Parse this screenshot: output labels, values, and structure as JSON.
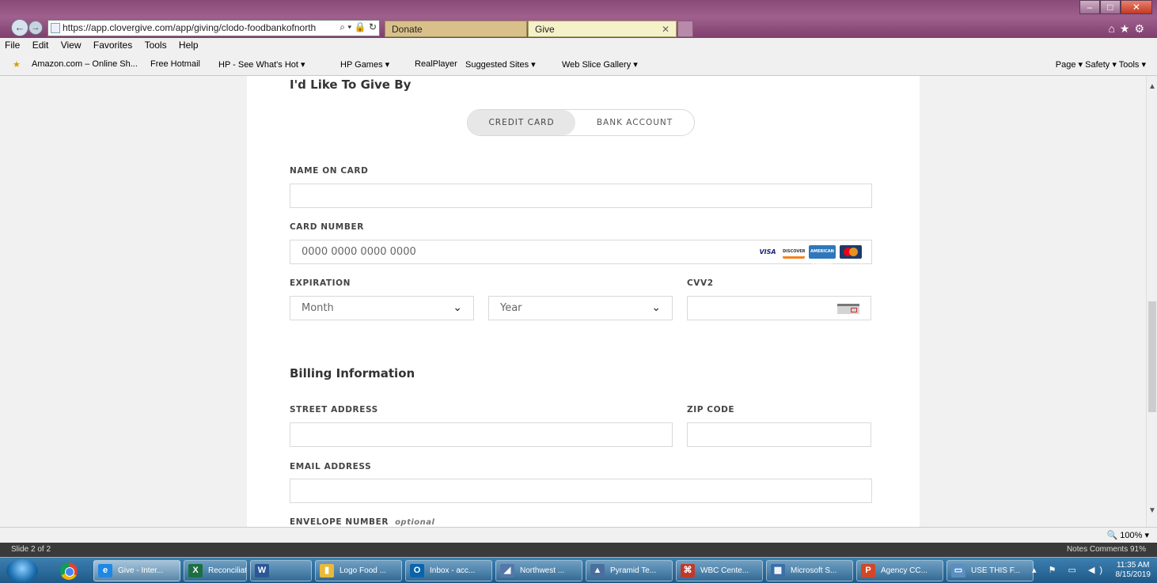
{
  "browser": {
    "url": "https://app.clovergive.com/app/giving/clodo-foodbankofnorth",
    "tabs": [
      {
        "label": "Donate"
      },
      {
        "label": "Give"
      }
    ],
    "menu": [
      "File",
      "Edit",
      "View",
      "Favorites",
      "Tools",
      "Help"
    ],
    "favorites": [
      "Amazon.com – Online Sh...",
      "Free Hotmail",
      "HP - See What's Hot ▾",
      "HP Games ▾",
      "RealPlayer",
      "Suggested Sites ▾",
      "Web Slice Gallery ▾"
    ],
    "command_bar": "Page ▾   Safety ▾   Tools ▾",
    "zoom": "100%"
  },
  "form": {
    "give_by_heading": "I'd Like To Give By",
    "payment_toggle": {
      "credit_card": "CREDIT CARD",
      "bank_account": "BANK ACCOUNT",
      "selected": "credit_card"
    },
    "name_on_card_label": "NAME ON CARD",
    "name_on_card_value": "",
    "card_number_label": "CARD NUMBER",
    "card_number_placeholder": "0000 0000 0000 0000",
    "card_brands": [
      "VISA",
      "DISCOVER",
      "AMERICAN EXPRESS",
      "MASTERCARD"
    ],
    "expiration_label": "EXPIRATION",
    "month_placeholder": "Month",
    "year_placeholder": "Year",
    "cvv_label": "CVV2",
    "billing_heading": "Billing Information",
    "street_label": "STREET ADDRESS",
    "zip_label": "ZIP CODE",
    "email_label": "EMAIL ADDRESS",
    "envelope_label": "ENVELOPE NUMBER",
    "envelope_optional": "optional"
  },
  "ppt_status": {
    "left": "Slide 2 of 2",
    "right": "Notes    Comments                 91%"
  },
  "taskbar": {
    "items": [
      {
        "label": "Give - Inter...",
        "icon": "ie-icon",
        "color": "#1e88e5"
      },
      {
        "label": "Reconciliati...",
        "icon": "excel-icon",
        "color": "#1d6f42"
      },
      {
        "label": "",
        "icon": "word-icon",
        "color": "#2b5797"
      },
      {
        "label": "Logo Food ...",
        "icon": "folder-icon",
        "color": "#e8b93a"
      },
      {
        "label": "Inbox - acc...",
        "icon": "outlook-icon",
        "color": "#0a64ad"
      },
      {
        "label": "Northwest ...",
        "icon": "app-icon",
        "color": "#5577aa"
      },
      {
        "label": "Pyramid Te...",
        "icon": "pyramid-icon",
        "color": "#4a6f9e"
      },
      {
        "label": "WBC Cente...",
        "icon": "pdf-icon",
        "color": "#c0392b"
      },
      {
        "label": "Microsoft S...",
        "icon": "network-icon",
        "color": "#3a6fa8"
      },
      {
        "label": "Agency CC...",
        "icon": "powerpoint-icon",
        "color": "#d24726"
      },
      {
        "label": "USE THIS F...",
        "icon": "image-icon",
        "color": "#5a8fc0"
      }
    ],
    "time": "11:35 AM",
    "date": "8/15/2019"
  }
}
